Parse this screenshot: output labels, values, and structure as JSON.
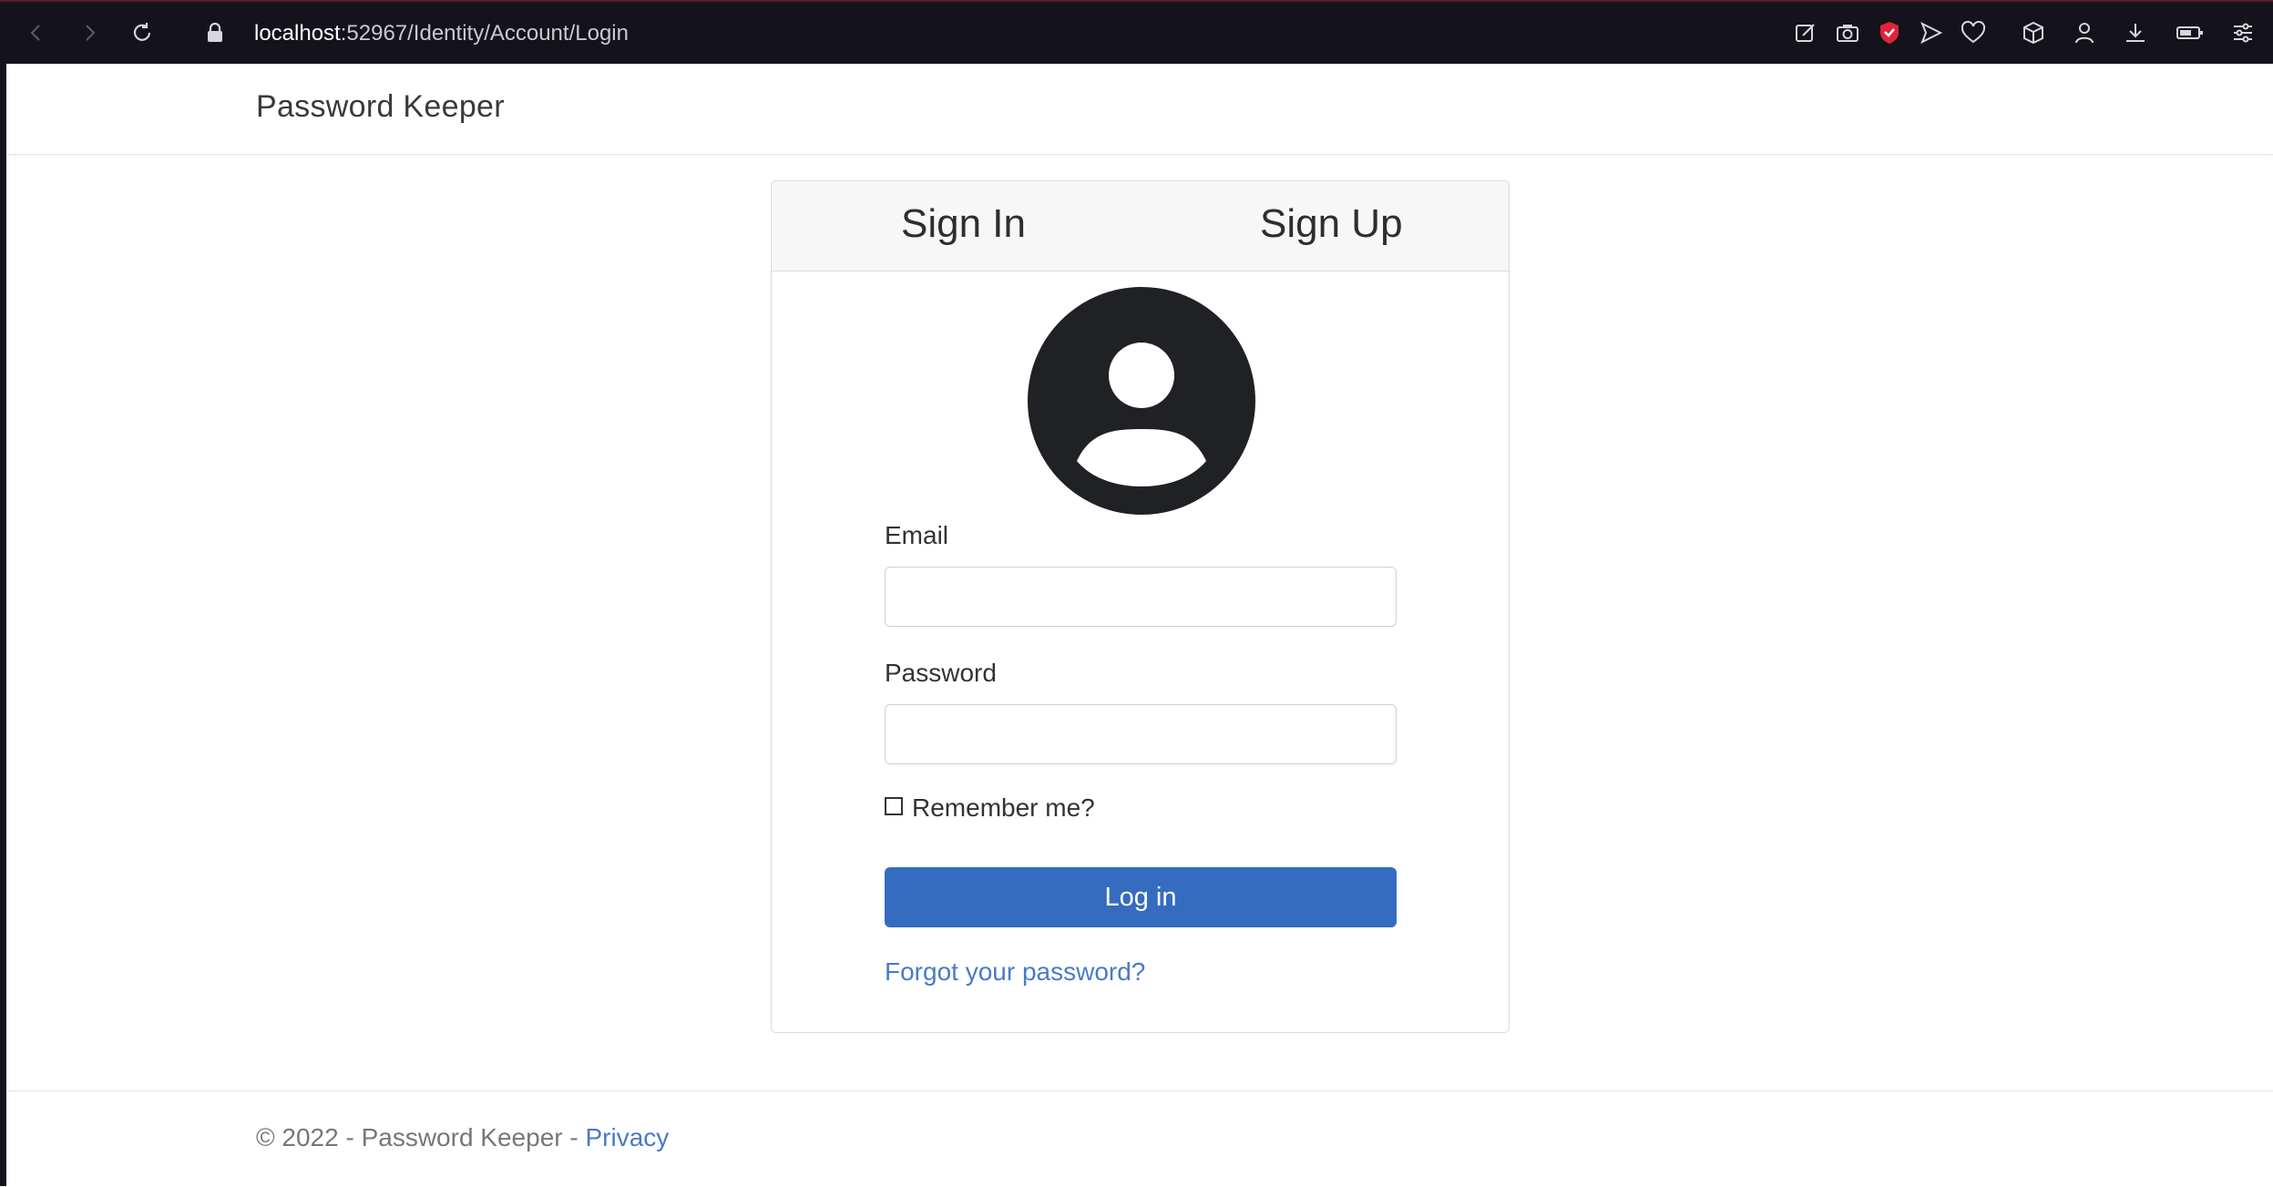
{
  "browser": {
    "url_host": "localhost",
    "url_rest": ":52967/Identity/Account/Login",
    "icons": [
      "back-icon",
      "forward-icon",
      "reload-icon",
      "lock-icon",
      "edit-icon",
      "camera-icon",
      "shield-icon",
      "send-icon",
      "heart-icon",
      "cube-icon",
      "profile-icon",
      "download-icon",
      "battery-icon",
      "menu-icon"
    ],
    "accent_color": "#e0243c"
  },
  "navbar": {
    "brand": "Password Keeper"
  },
  "card": {
    "tabs": [
      {
        "label": "Sign In"
      },
      {
        "label": "Sign Up"
      }
    ],
    "email_label": "Email",
    "email_value": "",
    "password_label": "Password",
    "password_value": "",
    "remember_label": "Remember me?",
    "login_label": "Log in",
    "forgot_label": "Forgot your password?",
    "button_color": "#356cc0"
  },
  "footer": {
    "text": "© 2022 - Password Keeper - ",
    "privacy": "Privacy"
  }
}
